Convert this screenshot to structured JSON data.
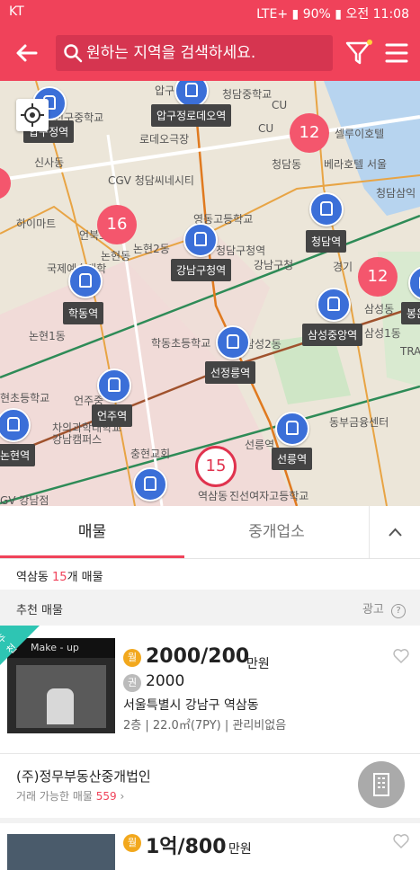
{
  "status_bar": {
    "left": "KT",
    "battery": "90%",
    "time": "오전 11:08",
    "network": "LTE+"
  },
  "search": {
    "placeholder": "원하는 지역을 검색하세요."
  },
  "map": {
    "labels": [
      "압구",
      "신구중학교",
      "로데오극장",
      "청담중학교",
      "CU",
      "CU",
      "셀루이호텔",
      "신사동",
      "CGV 청담씨네시티",
      "청담동",
      "베라호텔 서울",
      "청담삼익",
      "하이마트",
      "영동고등학교",
      "언북초",
      "논현2동",
      "청담구청역",
      "강남구청",
      "논현동",
      "국제예술대학",
      "삼성동",
      "경기",
      "논현1동",
      "학동초등학교",
      "삼성2동",
      "삼성1동",
      "현초등학교",
      "언주중",
      "차의과학대학교 강남캠퍼스",
      "동부금융센터",
      "충현교회",
      "선릉역",
      "GV 강남점",
      "역삼동",
      "진선여자고등학교",
      "TRA"
    ],
    "stations": [
      "압구정역",
      "압구정로데오역",
      "청담역",
      "강남구청역",
      "학동역",
      "삼성중앙역",
      "선정릉역",
      "언주역",
      "논현역",
      "선릉역",
      "봉은"
    ],
    "clusters": [
      "12",
      "16",
      "12",
      "15"
    ]
  },
  "tabs": {
    "listings": "매물",
    "agencies": "중개업소"
  },
  "info": {
    "area": "역삼동",
    "count": "15",
    "suffix": "개 매물"
  },
  "section": {
    "title": "추천 매물",
    "ad": "광고"
  },
  "listing1": {
    "badge": "추천",
    "thumb_sign": "Make - up",
    "type_pill": "월",
    "price": "2000/200",
    "unit": "만원",
    "premium_pill": "권",
    "premium": "2000",
    "address": "서울특별시 강남구 역삼동",
    "details": "2층 | 22.0㎡(7PY) | 관리비없음"
  },
  "broker": {
    "name": "(주)정무부동산중개법인",
    "available_label": "거래 가능한 매물",
    "available_count": "559"
  },
  "listing2": {
    "type_pill": "월",
    "price": "1억/800",
    "unit": "만원"
  },
  "colors": {
    "brand": "#f0425a",
    "station": "#3b6fd8",
    "cluster": "#f4566d",
    "recommend": "#2ec5b3",
    "monthly_pill": "#f2a81d",
    "premium_pill": "#bbbbbb"
  }
}
